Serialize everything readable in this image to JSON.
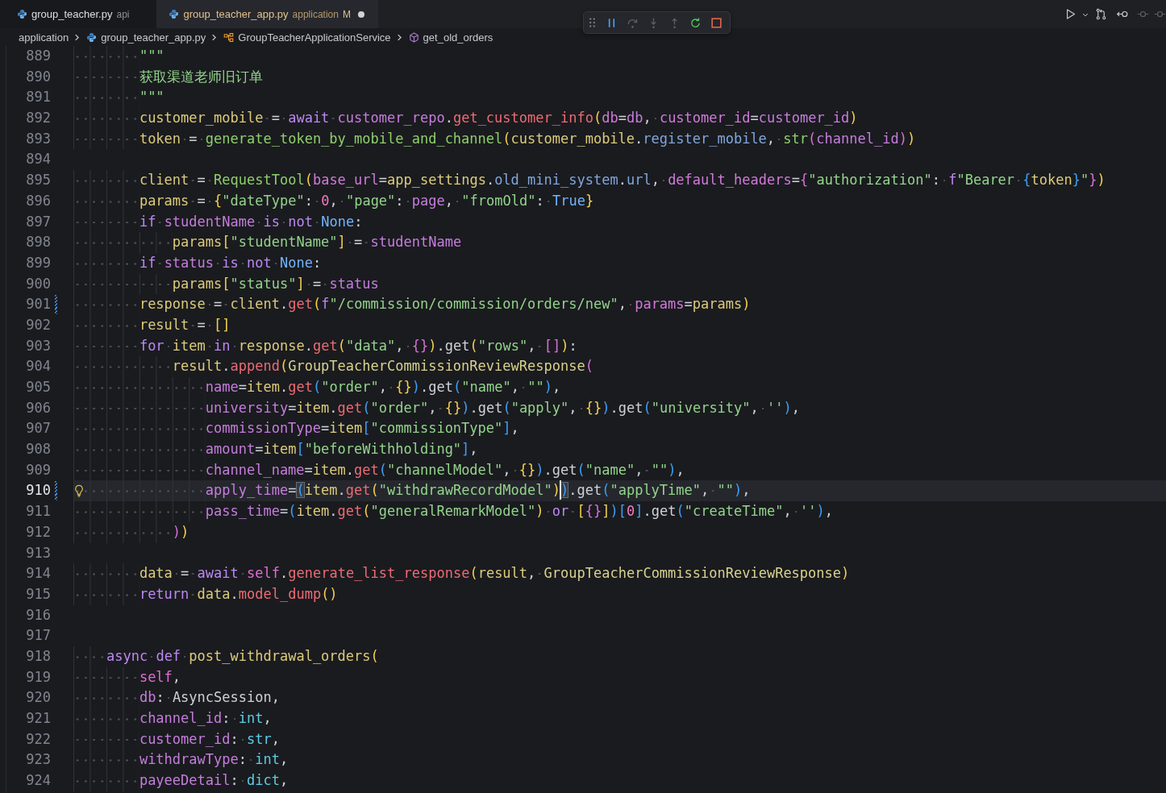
{
  "tabs": [
    {
      "filename": "group_teacher.py",
      "description": "api",
      "selected": false,
      "modified": false,
      "dirty": false
    },
    {
      "filename": "group_teacher_app.py",
      "description": "application",
      "git_status": "M",
      "selected": true,
      "modified": true,
      "dirty": true
    }
  ],
  "debug_toolbar": {
    "buttons": [
      {
        "kind": "pause",
        "disabled": false
      },
      {
        "kind": "step_over",
        "disabled": true
      },
      {
        "kind": "step_into",
        "disabled": true
      },
      {
        "kind": "step_out",
        "disabled": true
      },
      {
        "kind": "restart",
        "disabled": false
      },
      {
        "kind": "stop",
        "disabled": false
      }
    ]
  },
  "editor_actions": [
    {
      "kind": "run",
      "disabled": false
    },
    {
      "kind": "menu",
      "disabled": false
    },
    {
      "kind": "compare",
      "disabled": false
    },
    {
      "kind": "back",
      "disabled": false
    },
    {
      "kind": "commit",
      "disabled": true
    },
    {
      "kind": "commit",
      "disabled": true
    }
  ],
  "breadcrumb": [
    {
      "kind": "folder",
      "label": "application"
    },
    {
      "kind": "file",
      "label": "group_teacher_app.py"
    },
    {
      "kind": "class",
      "label": "GroupTeacherApplicationService"
    },
    {
      "kind": "method",
      "label": "get_old_orders"
    }
  ],
  "editor": {
    "lines": [
      {
        "number": "889",
        "current": false,
        "modified": false,
        "lightbulb": false,
        "tokens": [
          {
            "kind": "str",
            "text": "        \"\"\""
          }
        ]
      },
      {
        "number": "890",
        "current": false,
        "modified": false,
        "lightbulb": false,
        "tokens": [
          {
            "kind": "str",
            "text": "        获取渠道老师旧订单"
          }
        ]
      },
      {
        "number": "891",
        "current": false,
        "modified": false,
        "lightbulb": false,
        "tokens": [
          {
            "kind": "str",
            "text": "        \"\"\""
          }
        ]
      },
      {
        "number": "892",
        "current": false,
        "modified": false,
        "lightbulb": false,
        "tokens": [
          {
            "kind": "var",
            "text": "        customer_mobile"
          },
          {
            "kind": "plain",
            "text": " = "
          },
          {
            "kind": "kw",
            "text": "await "
          },
          {
            "kind": "param",
            "text": "customer_repo"
          },
          {
            "kind": "plain",
            "text": "."
          },
          {
            "kind": "method",
            "text": "get_customer_info"
          },
          {
            "kind": "bracket1",
            "text": "("
          },
          {
            "kind": "kwarg",
            "text": "db"
          },
          {
            "kind": "plain",
            "text": "="
          },
          {
            "kind": "param",
            "text": "db"
          },
          {
            "kind": "plain",
            "text": ", "
          },
          {
            "kind": "kwarg",
            "text": "customer_id"
          },
          {
            "kind": "plain",
            "text": "="
          },
          {
            "kind": "param",
            "text": "customer_id"
          },
          {
            "kind": "bracket1",
            "text": ")"
          }
        ]
      },
      {
        "number": "893",
        "current": false,
        "modified": false,
        "lightbulb": false,
        "tokens": [
          {
            "kind": "var",
            "text": "        token"
          },
          {
            "kind": "plain",
            "text": " = "
          },
          {
            "kind": "func",
            "text": "generate_token_by_mobile_and_channel"
          },
          {
            "kind": "bracket1",
            "text": "("
          },
          {
            "kind": "var",
            "text": "customer_mobile"
          },
          {
            "kind": "plain",
            "text": "."
          },
          {
            "kind": "attr",
            "text": "register_mobile"
          },
          {
            "kind": "plain",
            "text": ", "
          },
          {
            "kind": "func",
            "text": "str"
          },
          {
            "kind": "bracket2",
            "text": "("
          },
          {
            "kind": "param",
            "text": "channel_id"
          },
          {
            "kind": "bracket2",
            "text": ")"
          },
          {
            "kind": "bracket1",
            "text": ")"
          }
        ]
      },
      {
        "number": "894",
        "current": false,
        "modified": false,
        "lightbulb": false
      },
      {
        "number": "895",
        "current": false,
        "modified": false,
        "lightbulb": false,
        "tokens": [
          {
            "kind": "var",
            "text": "        client"
          },
          {
            "kind": "plain",
            "text": " = "
          },
          {
            "kind": "func",
            "text": "RequestTool"
          },
          {
            "kind": "bracket1",
            "text": "("
          },
          {
            "kind": "kwarg",
            "text": "base_url"
          },
          {
            "kind": "plain",
            "text": "="
          },
          {
            "kind": "var",
            "text": "app_settings"
          },
          {
            "kind": "plain",
            "text": "."
          },
          {
            "kind": "attr",
            "text": "old_mini_system"
          },
          {
            "kind": "plain",
            "text": "."
          },
          {
            "kind": "attr",
            "text": "url"
          },
          {
            "kind": "plain",
            "text": ", "
          },
          {
            "kind": "kwarg",
            "text": "default_headers"
          },
          {
            "kind": "plain",
            "text": "="
          },
          {
            "kind": "bracket2",
            "text": "{"
          },
          {
            "kind": "str",
            "text": "\"authorization\""
          },
          {
            "kind": "plain",
            "text": ": "
          },
          {
            "kind": "kw",
            "text": "f"
          },
          {
            "kind": "str",
            "text": "\"Bearer "
          },
          {
            "kind": "bracket3",
            "text": "{"
          },
          {
            "kind": "var",
            "text": "token"
          },
          {
            "kind": "bracket3",
            "text": "}"
          },
          {
            "kind": "str",
            "text": "\""
          },
          {
            "kind": "bracket2",
            "text": "}"
          },
          {
            "kind": "bracket1",
            "text": ")"
          }
        ]
      },
      {
        "number": "896",
        "current": false,
        "modified": false,
        "lightbulb": false,
        "tokens": [
          {
            "kind": "var",
            "text": "        params"
          },
          {
            "kind": "plain",
            "text": " = "
          },
          {
            "kind": "bracket1",
            "text": "{"
          },
          {
            "kind": "str",
            "text": "\"dateType\""
          },
          {
            "kind": "plain",
            "text": ": "
          },
          {
            "kind": "num",
            "text": "0"
          },
          {
            "kind": "plain",
            "text": ", "
          },
          {
            "kind": "str",
            "text": "\"page\""
          },
          {
            "kind": "plain",
            "text": ": "
          },
          {
            "kind": "param",
            "text": "page"
          },
          {
            "kind": "plain",
            "text": ", "
          },
          {
            "kind": "str",
            "text": "\"fromOld\""
          },
          {
            "kind": "plain",
            "text": ": "
          },
          {
            "kind": "const",
            "text": "True"
          },
          {
            "kind": "bracket1",
            "text": "}"
          }
        ]
      },
      {
        "number": "897",
        "current": false,
        "modified": false,
        "lightbulb": false,
        "tokens": [
          {
            "kind": "kw",
            "text": "        if "
          },
          {
            "kind": "param",
            "text": "studentName "
          },
          {
            "kind": "kw",
            "text": "is not "
          },
          {
            "kind": "const",
            "text": "None"
          },
          {
            "kind": "plain",
            "text": ":"
          }
        ]
      },
      {
        "number": "898",
        "current": false,
        "modified": false,
        "lightbulb": false,
        "tokens": [
          {
            "kind": "var",
            "text": "            params"
          },
          {
            "kind": "bracket1",
            "text": "["
          },
          {
            "kind": "str",
            "text": "\"studentName\""
          },
          {
            "kind": "bracket1",
            "text": "]"
          },
          {
            "kind": "plain",
            "text": " = "
          },
          {
            "kind": "param",
            "text": "studentName"
          }
        ]
      },
      {
        "number": "899",
        "current": false,
        "modified": false,
        "lightbulb": false,
        "tokens": [
          {
            "kind": "kw",
            "text": "        if "
          },
          {
            "kind": "param",
            "text": "status "
          },
          {
            "kind": "kw",
            "text": "is not "
          },
          {
            "kind": "const",
            "text": "None"
          },
          {
            "kind": "plain",
            "text": ":"
          }
        ]
      },
      {
        "number": "900",
        "current": false,
        "modified": false,
        "lightbulb": false,
        "tokens": [
          {
            "kind": "var",
            "text": "            params"
          },
          {
            "kind": "bracket1",
            "text": "["
          },
          {
            "kind": "str",
            "text": "\"status\""
          },
          {
            "kind": "bracket1",
            "text": "]"
          },
          {
            "kind": "plain",
            "text": " = "
          },
          {
            "kind": "param",
            "text": "status"
          }
        ]
      },
      {
        "number": "901",
        "current": false,
        "modified": true,
        "lightbulb": false,
        "tokens": [
          {
            "kind": "var",
            "text": "        response"
          },
          {
            "kind": "plain",
            "text": " = "
          },
          {
            "kind": "var",
            "text": "client"
          },
          {
            "kind": "plain",
            "text": "."
          },
          {
            "kind": "method",
            "text": "get"
          },
          {
            "kind": "bracket1",
            "text": "("
          },
          {
            "kind": "kw",
            "text": "f"
          },
          {
            "kind": "str",
            "text": "\"/commission/commission/orders/new\""
          },
          {
            "kind": "plain",
            "text": ", "
          },
          {
            "kind": "kwarg",
            "text": "params"
          },
          {
            "kind": "plain",
            "text": "="
          },
          {
            "kind": "var",
            "text": "params"
          },
          {
            "kind": "bracket1",
            "text": ")"
          }
        ]
      },
      {
        "number": "902",
        "current": false,
        "modified": false,
        "lightbulb": false,
        "tokens": [
          {
            "kind": "var",
            "text": "        result"
          },
          {
            "kind": "plain",
            "text": " = "
          },
          {
            "kind": "bracket1",
            "text": "[]"
          }
        ]
      },
      {
        "number": "903",
        "current": false,
        "modified": false,
        "lightbulb": false,
        "tokens": [
          {
            "kind": "kw",
            "text": "        for "
          },
          {
            "kind": "var",
            "text": "item "
          },
          {
            "kind": "kw",
            "text": "in "
          },
          {
            "kind": "var",
            "text": "response"
          },
          {
            "kind": "plain",
            "text": "."
          },
          {
            "kind": "method",
            "text": "get"
          },
          {
            "kind": "bracket1",
            "text": "("
          },
          {
            "kind": "str",
            "text": "\"data\""
          },
          {
            "kind": "plain",
            "text": ", "
          },
          {
            "kind": "bracket2",
            "text": "{}"
          },
          {
            "kind": "bracket1",
            "text": ")"
          },
          {
            "kind": "plain",
            "text": ".get"
          },
          {
            "kind": "bracket1",
            "text": "("
          },
          {
            "kind": "str",
            "text": "\"rows\""
          },
          {
            "kind": "plain",
            "text": ", "
          },
          {
            "kind": "bracket2",
            "text": "[]"
          },
          {
            "kind": "bracket1",
            "text": ")"
          },
          {
            "kind": "plain",
            "text": ":"
          }
        ]
      },
      {
        "number": "904",
        "current": false,
        "modified": false,
        "lightbulb": false,
        "tokens": [
          {
            "kind": "var",
            "text": "            result"
          },
          {
            "kind": "plain",
            "text": "."
          },
          {
            "kind": "method",
            "text": "append"
          },
          {
            "kind": "bracket1",
            "text": "("
          },
          {
            "kind": "cls",
            "text": "GroupTeacherCommissionReviewResponse"
          },
          {
            "kind": "bracket2",
            "text": "("
          }
        ]
      },
      {
        "number": "905",
        "current": false,
        "modified": false,
        "lightbulb": false,
        "tokens": [
          {
            "kind": "param",
            "text": "                name"
          },
          {
            "kind": "plain",
            "text": "="
          },
          {
            "kind": "var",
            "text": "item"
          },
          {
            "kind": "plain",
            "text": "."
          },
          {
            "kind": "method",
            "text": "get"
          },
          {
            "kind": "bracket3",
            "text": "("
          },
          {
            "kind": "str",
            "text": "\"order\""
          },
          {
            "kind": "plain",
            "text": ", "
          },
          {
            "kind": "bracket1",
            "text": "{}"
          },
          {
            "kind": "bracket3",
            "text": ")"
          },
          {
            "kind": "plain",
            "text": ".get"
          },
          {
            "kind": "bracket3",
            "text": "("
          },
          {
            "kind": "str",
            "text": "\"name\""
          },
          {
            "kind": "plain",
            "text": ", "
          },
          {
            "kind": "str",
            "text": "\"\""
          },
          {
            "kind": "bracket3",
            "text": ")"
          },
          {
            "kind": "plain",
            "text": ","
          }
        ]
      },
      {
        "number": "906",
        "current": false,
        "modified": false,
        "lightbulb": false,
        "tokens": [
          {
            "kind": "param",
            "text": "                university"
          },
          {
            "kind": "plain",
            "text": "="
          },
          {
            "kind": "var",
            "text": "item"
          },
          {
            "kind": "plain",
            "text": "."
          },
          {
            "kind": "method",
            "text": "get"
          },
          {
            "kind": "bracket3",
            "text": "("
          },
          {
            "kind": "str",
            "text": "\"order\""
          },
          {
            "kind": "plain",
            "text": ", "
          },
          {
            "kind": "bracket1",
            "text": "{}"
          },
          {
            "kind": "bracket3",
            "text": ")"
          },
          {
            "kind": "plain",
            "text": ".get"
          },
          {
            "kind": "bracket3",
            "text": "("
          },
          {
            "kind": "str",
            "text": "\"apply\""
          },
          {
            "kind": "plain",
            "text": ", "
          },
          {
            "kind": "bracket1",
            "text": "{}"
          },
          {
            "kind": "bracket3",
            "text": ")"
          },
          {
            "kind": "plain",
            "text": ".get"
          },
          {
            "kind": "bracket3",
            "text": "("
          },
          {
            "kind": "str",
            "text": "\"university\""
          },
          {
            "kind": "plain",
            "text": ", "
          },
          {
            "kind": "str",
            "text": "''"
          },
          {
            "kind": "bracket3",
            "text": ")"
          },
          {
            "kind": "plain",
            "text": ","
          }
        ]
      },
      {
        "number": "907",
        "current": false,
        "modified": false,
        "lightbulb": false,
        "tokens": [
          {
            "kind": "param",
            "text": "                commissionType"
          },
          {
            "kind": "plain",
            "text": "="
          },
          {
            "kind": "var",
            "text": "item"
          },
          {
            "kind": "bracket3",
            "text": "["
          },
          {
            "kind": "str",
            "text": "\"commissionType\""
          },
          {
            "kind": "bracket3",
            "text": "]"
          },
          {
            "kind": "plain",
            "text": ","
          }
        ]
      },
      {
        "number": "908",
        "current": false,
        "modified": false,
        "lightbulb": false,
        "tokens": [
          {
            "kind": "param",
            "text": "                amount"
          },
          {
            "kind": "plain",
            "text": "="
          },
          {
            "kind": "var",
            "text": "item"
          },
          {
            "kind": "bracket3",
            "text": "["
          },
          {
            "kind": "str",
            "text": "\"beforeWithholding\""
          },
          {
            "kind": "bracket3",
            "text": "]"
          },
          {
            "kind": "plain",
            "text": ","
          }
        ]
      },
      {
        "number": "909",
        "current": false,
        "modified": false,
        "lightbulb": false,
        "tokens": [
          {
            "kind": "param",
            "text": "                channel_name"
          },
          {
            "kind": "plain",
            "text": "="
          },
          {
            "kind": "var",
            "text": "item"
          },
          {
            "kind": "plain",
            "text": "."
          },
          {
            "kind": "method",
            "text": "get"
          },
          {
            "kind": "bracket3",
            "text": "("
          },
          {
            "kind": "str",
            "text": "\"channelModel\""
          },
          {
            "kind": "plain",
            "text": ", "
          },
          {
            "kind": "bracket1",
            "text": "{}"
          },
          {
            "kind": "bracket3",
            "text": ")"
          },
          {
            "kind": "plain",
            "text": ".get"
          },
          {
            "kind": "bracket3",
            "text": "("
          },
          {
            "kind": "str",
            "text": "\"name\""
          },
          {
            "kind": "plain",
            "text": ", "
          },
          {
            "kind": "str",
            "text": "\"\""
          },
          {
            "kind": "bracket3",
            "text": ")"
          },
          {
            "kind": "plain",
            "text": ","
          }
        ]
      },
      {
        "number": "910",
        "current": true,
        "modified": true,
        "lightbulb": true,
        "tokens": [
          {
            "kind": "param",
            "text": "                apply_time"
          },
          {
            "kind": "plain",
            "text": "="
          },
          {
            "kind": "matched",
            "text": "("
          },
          {
            "kind": "var",
            "text": "item"
          },
          {
            "kind": "plain",
            "text": "."
          },
          {
            "kind": "method",
            "text": "get"
          },
          {
            "kind": "bracket1",
            "text": "("
          },
          {
            "kind": "str",
            "text": "\"withdrawRecordModel\""
          },
          {
            "kind": "bracket1",
            "text": ")"
          },
          {
            "kind": "matched_caret",
            "text": ")"
          },
          {
            "kind": "plain",
            "text": ".get"
          },
          {
            "kind": "bracket3",
            "text": "("
          },
          {
            "kind": "str",
            "text": "\"applyTime\""
          },
          {
            "kind": "plain",
            "text": ", "
          },
          {
            "kind": "str",
            "text": "\"\""
          },
          {
            "kind": "bracket3",
            "text": ")"
          },
          {
            "kind": "plain",
            "text": ","
          }
        ]
      },
      {
        "number": "911",
        "current": false,
        "modified": false,
        "lightbulb": false,
        "tokens": [
          {
            "kind": "param",
            "text": "                pass_time"
          },
          {
            "kind": "plain",
            "text": "="
          },
          {
            "kind": "bracket3",
            "text": "("
          },
          {
            "kind": "var",
            "text": "item"
          },
          {
            "kind": "plain",
            "text": "."
          },
          {
            "kind": "method",
            "text": "get"
          },
          {
            "kind": "bracket1",
            "text": "("
          },
          {
            "kind": "str",
            "text": "\"generalRemarkModel\""
          },
          {
            "kind": "bracket1",
            "text": ")"
          },
          {
            "kind": "kw",
            "text": " or "
          },
          {
            "kind": "bracket1",
            "text": "["
          },
          {
            "kind": "bracket2",
            "text": "{}"
          },
          {
            "kind": "bracket1",
            "text": "]"
          },
          {
            "kind": "bracket3",
            "text": ")"
          },
          {
            "kind": "bracket3",
            "text": "["
          },
          {
            "kind": "num",
            "text": "0"
          },
          {
            "kind": "bracket3",
            "text": "]"
          },
          {
            "kind": "plain",
            "text": ".get"
          },
          {
            "kind": "bracket3",
            "text": "("
          },
          {
            "kind": "str",
            "text": "\"createTime\""
          },
          {
            "kind": "plain",
            "text": ", "
          },
          {
            "kind": "str",
            "text": "''"
          },
          {
            "kind": "bracket3",
            "text": ")"
          },
          {
            "kind": "plain",
            "text": ","
          }
        ]
      },
      {
        "number": "912",
        "current": false,
        "modified": false,
        "lightbulb": false,
        "tokens": [
          {
            "kind": "bracket2",
            "text": "            )"
          },
          {
            "kind": "bracket1",
            "text": ")"
          }
        ]
      },
      {
        "number": "913",
        "current": false,
        "modified": false,
        "lightbulb": false
      },
      {
        "number": "914",
        "current": false,
        "modified": false,
        "lightbulb": false,
        "tokens": [
          {
            "kind": "var",
            "text": "        data"
          },
          {
            "kind": "plain",
            "text": " = "
          },
          {
            "kind": "kw",
            "text": "await "
          },
          {
            "kind": "self",
            "text": "self"
          },
          {
            "kind": "plain",
            "text": "."
          },
          {
            "kind": "method",
            "text": "generate_list_response"
          },
          {
            "kind": "bracket1",
            "text": "("
          },
          {
            "kind": "var",
            "text": "result"
          },
          {
            "kind": "plain",
            "text": ", "
          },
          {
            "kind": "cls",
            "text": "GroupTeacherCommissionReviewResponse"
          },
          {
            "kind": "bracket1",
            "text": ")"
          }
        ]
      },
      {
        "number": "915",
        "current": false,
        "modified": false,
        "lightbulb": false,
        "tokens": [
          {
            "kind": "kw",
            "text": "        return "
          },
          {
            "kind": "var",
            "text": "data"
          },
          {
            "kind": "plain",
            "text": "."
          },
          {
            "kind": "method",
            "text": "model_dump"
          },
          {
            "kind": "bracket1",
            "text": "()"
          }
        ]
      },
      {
        "number": "916",
        "current": false,
        "modified": false,
        "lightbulb": false
      },
      {
        "number": "917",
        "current": false,
        "modified": false,
        "lightbulb": false
      },
      {
        "number": "918",
        "current": false,
        "modified": false,
        "lightbulb": false,
        "tokens": [
          {
            "kind": "kw",
            "text": "    async def "
          },
          {
            "kind": "var",
            "text": "post_withdrawal_orders"
          },
          {
            "kind": "bracket1",
            "text": "("
          }
        ]
      },
      {
        "number": "919",
        "current": false,
        "modified": false,
        "lightbulb": false,
        "tokens": [
          {
            "kind": "self",
            "text": "        self"
          },
          {
            "kind": "plain",
            "text": ","
          }
        ]
      },
      {
        "number": "920",
        "current": false,
        "modified": false,
        "lightbulb": false,
        "tokens": [
          {
            "kind": "param",
            "text": "        db"
          },
          {
            "kind": "plain",
            "text": ": AsyncSession,"
          }
        ]
      },
      {
        "number": "921",
        "current": false,
        "modified": false,
        "lightbulb": false,
        "tokens": [
          {
            "kind": "param",
            "text": "        channel_id"
          },
          {
            "kind": "plain",
            "text": ": "
          },
          {
            "kind": "type",
            "text": "int"
          },
          {
            "kind": "plain",
            "text": ","
          }
        ]
      },
      {
        "number": "922",
        "current": false,
        "modified": false,
        "lightbulb": false,
        "tokens": [
          {
            "kind": "param",
            "text": "        customer_id"
          },
          {
            "kind": "plain",
            "text": ": "
          },
          {
            "kind": "type",
            "text": "str"
          },
          {
            "kind": "plain",
            "text": ","
          }
        ]
      },
      {
        "number": "923",
        "current": false,
        "modified": false,
        "lightbulb": false,
        "tokens": [
          {
            "kind": "param",
            "text": "        withdrawType"
          },
          {
            "kind": "plain",
            "text": ": "
          },
          {
            "kind": "type",
            "text": "int"
          },
          {
            "kind": "plain",
            "text": ","
          }
        ]
      },
      {
        "number": "924",
        "current": false,
        "modified": false,
        "lightbulb": false,
        "tokens": [
          {
            "kind": "param",
            "text": "        payeeDetail"
          },
          {
            "kind": "plain",
            "text": ": "
          },
          {
            "kind": "type",
            "text": "dict"
          },
          {
            "kind": "plain",
            "text": ","
          }
        ]
      }
    ]
  }
}
